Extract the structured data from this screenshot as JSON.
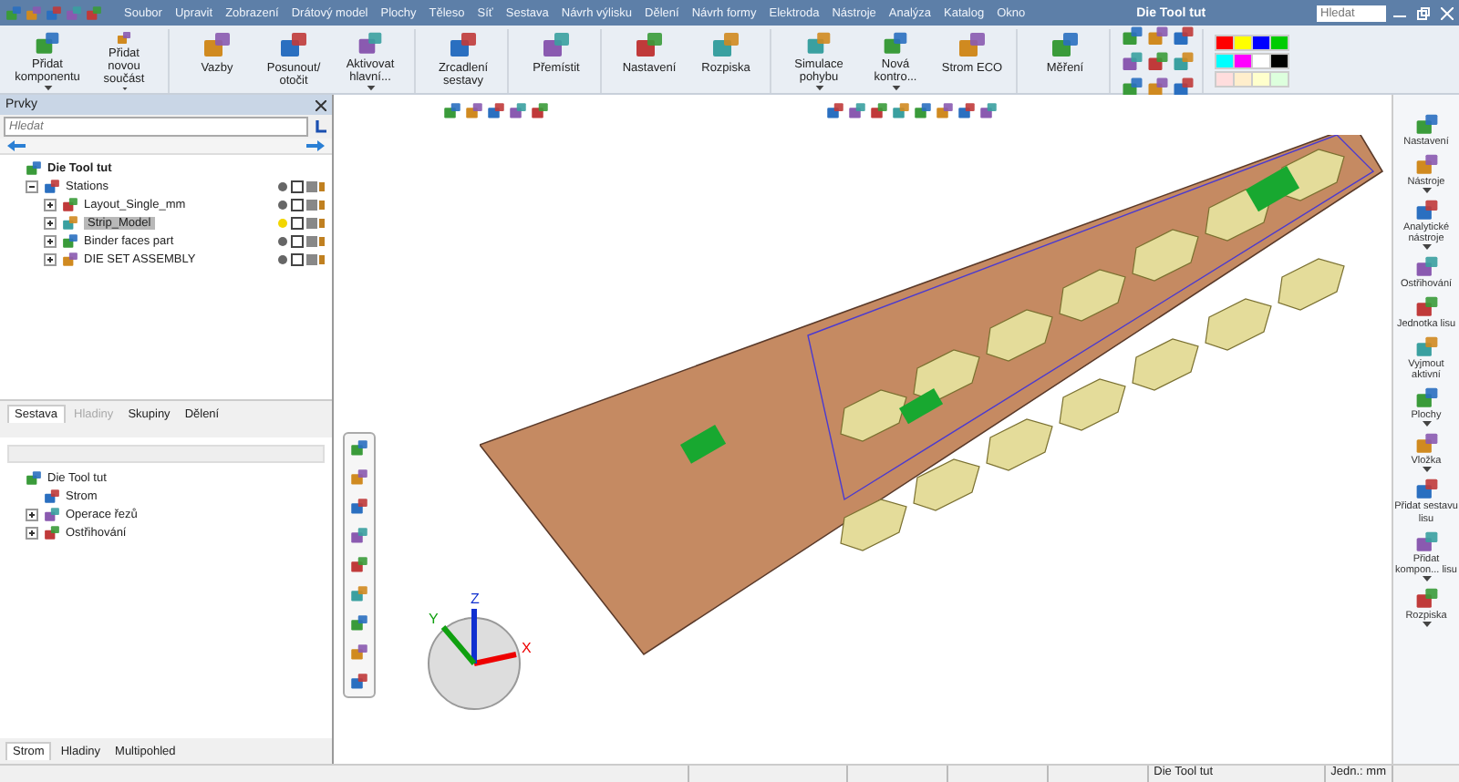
{
  "window": {
    "title": "Die Tool tut",
    "search": {
      "placeholder": "Hledat"
    }
  },
  "menu": [
    "Soubor",
    "Upravit",
    "Zobrazení",
    "Drátový model",
    "Plochy",
    "Těleso",
    "Síť",
    "Sestava",
    "Návrh výlisku",
    "Dělení",
    "Návrh formy",
    "Elektroda",
    "Nástroje",
    "Analýza",
    "Katalog",
    "Okno"
  ],
  "ribbon": {
    "groups": [
      {
        "buttons": [
          {
            "label": "Přidat komponentu",
            "dropdown": true
          },
          {
            "label": "Přidat novou součást",
            "dropdown": true
          }
        ]
      },
      {
        "buttons": [
          {
            "label": "Vazby",
            "dropdown": false
          },
          {
            "label": "Posunout/ otočit",
            "dropdown": false
          },
          {
            "label": "Aktivovat hlavní...",
            "dropdown": true
          }
        ]
      },
      {
        "buttons": [
          {
            "label": "Zrcadlení sestavy",
            "dropdown": false
          }
        ]
      },
      {
        "buttons": [
          {
            "label": "Přemístit",
            "dropdown": false
          }
        ]
      },
      {
        "buttons": [
          {
            "label": "Nastavení",
            "dropdown": false
          },
          {
            "label": "Rozpiska",
            "dropdown": false
          }
        ]
      },
      {
        "buttons": [
          {
            "label": "Simulace pohybu",
            "dropdown": true
          },
          {
            "label": "Nová kontro...",
            "dropdown": true
          },
          {
            "label": "Strom ECO",
            "dropdown": false
          }
        ]
      },
      {
        "buttons": [
          {
            "label": "Měření",
            "dropdown": false
          }
        ]
      }
    ]
  },
  "features_panel": {
    "title": "Prvky",
    "search": {
      "placeholder": "Hledat"
    },
    "tree": [
      {
        "label": "Die Tool tut",
        "selected": false,
        "children": [
          {
            "label": "Stations",
            "expanded": true,
            "selected": false,
            "children": [
              {
                "label": "Layout_Single_mm",
                "expanded": false,
                "selected": false
              },
              {
                "label": "Strip_Model",
                "expanded": false,
                "selected": true
              },
              {
                "label": "Binder faces part",
                "expanded": false,
                "selected": false
              },
              {
                "label": "DIE SET ASSEMBLY",
                "expanded": false,
                "selected": false
              }
            ]
          }
        ]
      }
    ],
    "tabs": [
      {
        "label": "Sestava",
        "selected": true,
        "disabled": false
      },
      {
        "label": "Hladiny",
        "selected": false,
        "disabled": true
      },
      {
        "label": "Skupiny",
        "selected": false,
        "disabled": false
      },
      {
        "label": "Dělení",
        "selected": false,
        "disabled": false
      }
    ],
    "lower_tree": [
      {
        "label": "Die Tool tut",
        "children": [
          {
            "label": "Strom"
          },
          {
            "label": "Operace řezů",
            "expanded": false
          },
          {
            "label": "Ostřihování",
            "expanded": false
          }
        ]
      }
    ],
    "bottom_tabs": [
      {
        "label": "Strom",
        "selected": true
      },
      {
        "label": "Hladiny",
        "selected": false
      },
      {
        "label": "Multipohled",
        "selected": false
      }
    ]
  },
  "viewport": {
    "axes": [
      "X",
      "Y",
      "Z"
    ]
  },
  "right_panel": [
    {
      "label": "Nastavení",
      "dropdown": false
    },
    {
      "label": "Nástroje",
      "dropdown": true
    },
    {
      "label": "Analytické nástroje",
      "dropdown": true
    },
    {
      "label": "Ostřihování",
      "dropdown": false
    },
    {
      "label": "Jednotka lisu",
      "dropdown": false
    },
    {
      "label": "Vyjmout aktivní",
      "dropdown": false
    },
    {
      "label": "Plochy",
      "dropdown": true
    },
    {
      "label": "Vložka",
      "dropdown": true
    },
    {
      "label": "Přidat sestavu lisu",
      "dropdown": false
    },
    {
      "label": "Přidat kompon... lisu",
      "dropdown": true
    },
    {
      "label": "Rozpiska",
      "dropdown": true
    }
  ],
  "status_bar": {
    "document": "Die Tool tut",
    "units": "Jedn.: mm"
  }
}
